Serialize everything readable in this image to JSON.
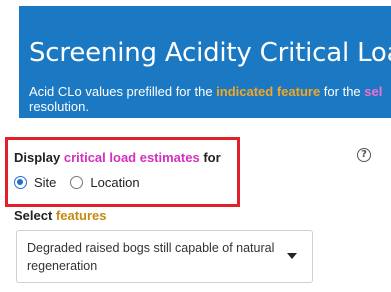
{
  "banner": {
    "title": "Screening Acidity Critical Load",
    "desc_prefix": "Acid CLo values prefilled for the ",
    "desc_highlight1": "indicated feature",
    "desc_middle": " for the ",
    "desc_highlight2": "sel",
    "desc_suffix": "resolution."
  },
  "display": {
    "label_prefix": "Display ",
    "label_highlight": "critical load estimates",
    "label_suffix": " for",
    "options": [
      {
        "label": "Site",
        "checked": true
      },
      {
        "label": "Location",
        "checked": false
      }
    ]
  },
  "help": {
    "glyph": "?"
  },
  "features": {
    "label_prefix": "Select ",
    "label_highlight": "features",
    "selected": "Degraded raised bogs still capable of natural regeneration"
  },
  "colors": {
    "banner_bg": "#1b78c2",
    "highlight_border": "#e2202a",
    "radio_accent": "#1f6fd1"
  }
}
